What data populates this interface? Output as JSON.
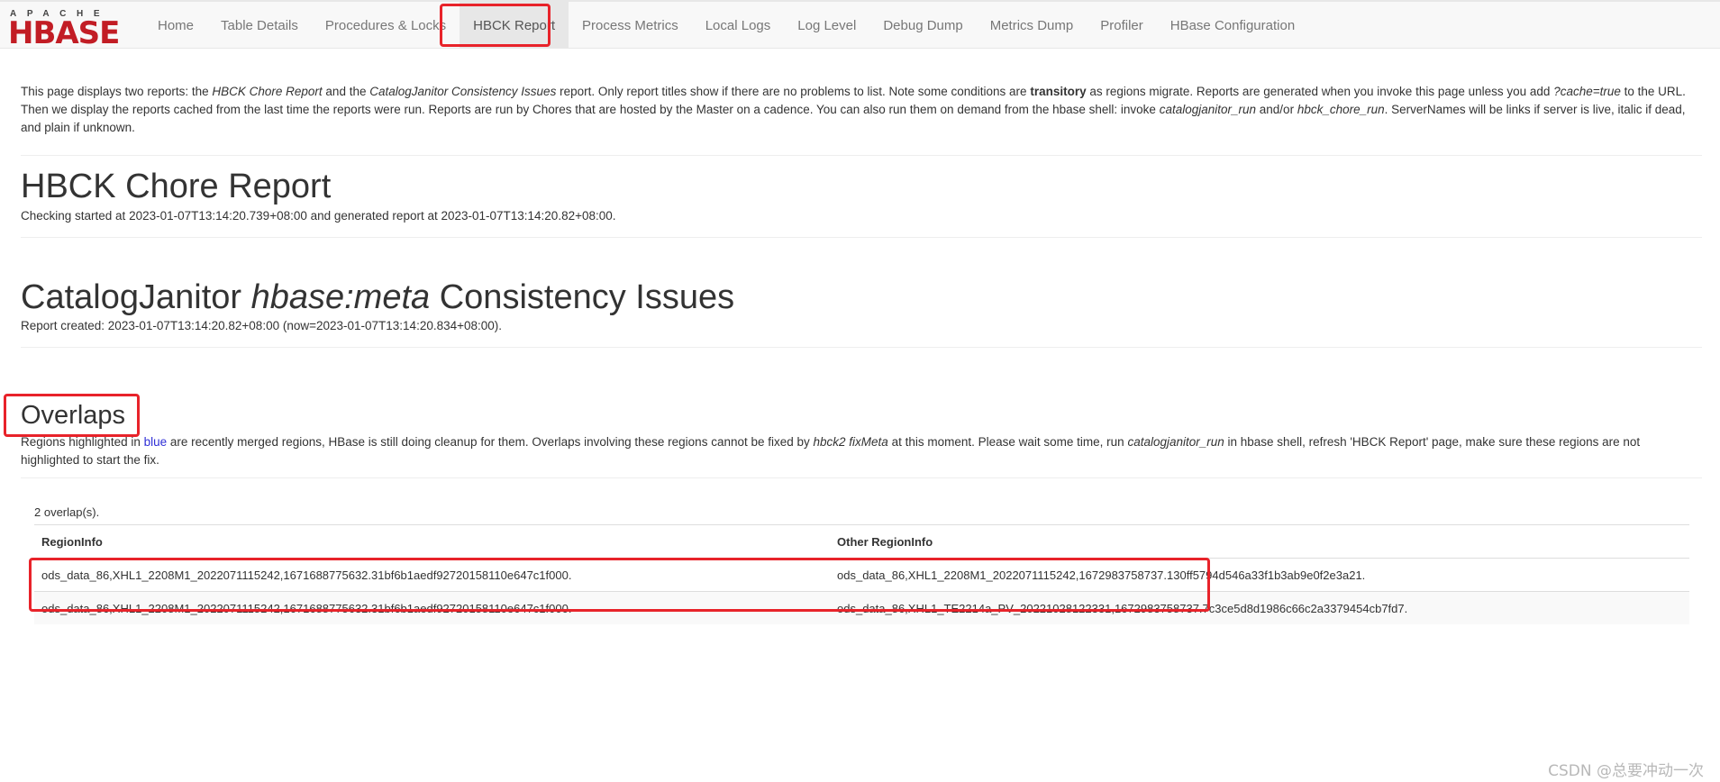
{
  "brand": {
    "top_text": "APACHE",
    "logo_text": "HBASE",
    "logo_color": "#c21d25"
  },
  "nav": {
    "items": [
      {
        "label": "Home"
      },
      {
        "label": "Table Details"
      },
      {
        "label": "Procedures & Locks"
      },
      {
        "label": "HBCK Report",
        "active": true
      },
      {
        "label": "Process Metrics"
      },
      {
        "label": "Local Logs"
      },
      {
        "label": "Log Level"
      },
      {
        "label": "Debug Dump"
      },
      {
        "label": "Metrics Dump"
      },
      {
        "label": "Profiler"
      },
      {
        "label": "HBase Configuration"
      }
    ]
  },
  "intro": {
    "t1": "This page displays two reports: the ",
    "i1": "HBCK Chore Report",
    "t2": " and the ",
    "i2": "CatalogJanitor Consistency Issues",
    "t3": " report. Only report titles show if there are no problems to list. Note some conditions are ",
    "b1": "transitory",
    "t4": " as regions migrate. Reports are generated when you invoke this page unless you add ",
    "i3": "?cache=true",
    "t5": " to the URL. Then we display the reports cached from the last time the reports were run. Reports are run by Chores that are hosted by the Master on a cadence. You can also run them on demand from the hbase shell: invoke ",
    "i4": "catalogjanitor_run",
    "t6": " and/or ",
    "i5": "hbck_chore_run",
    "t7": ". ServerNames will be links if server is live, italic if dead, and plain if unknown."
  },
  "chore_report": {
    "title": "HBCK Chore Report",
    "status": "Checking started at 2023-01-07T13:14:20.739+08:00 and generated report at 2023-01-07T13:14:20.82+08:00."
  },
  "catalog": {
    "title_a": "CatalogJanitor ",
    "title_b": "hbase:meta",
    "title_c": " Consistency Issues",
    "status": "Report created: 2023-01-07T13:14:20.82+08:00 (now=2023-01-07T13:14:20.834+08:00)."
  },
  "overlaps": {
    "title": "Overlaps",
    "d1": "Regions highlighted in ",
    "d_blue": "blue",
    "d2": " are recently merged regions, HBase is still doing cleanup for them. Overlaps involving these regions cannot be fixed by ",
    "d_i1": "hbck2 fixMeta",
    "d3": " at this moment. Please wait some time, run ",
    "d_i2": "catalogjanitor_run",
    "d4": " in hbase shell, refresh 'HBCK Report' page, make sure these regions are not highlighted to start the fix.",
    "count": "2 overlap(s).",
    "columns": [
      "RegionInfo",
      "Other RegionInfo"
    ],
    "rows": [
      [
        "ods_data_86,XHL1_2208M1_2022071115242,1671688775632.31bf6b1aedf92720158110e647c1f000.",
        "ods_data_86,XHL1_2208M1_2022071115242,1672983758737.130ff5794d546a33f1b3ab9e0f2e3a21."
      ],
      [
        "ods_data_86,XHL1_2208M1_2022071115242,1671688775632.31bf6b1aedf92720158110e647c1f000.",
        "ods_data_86,XHL1_TE2214a_PV_20221028122331,1672983758737.7c3ce5d8d1986c66c2a3379454cb7fd7."
      ]
    ]
  },
  "watermark": "CSDN @总要冲动一次",
  "colors": {
    "annotation_red": "#e8232a",
    "merged_blue": "#2f2fd6"
  }
}
